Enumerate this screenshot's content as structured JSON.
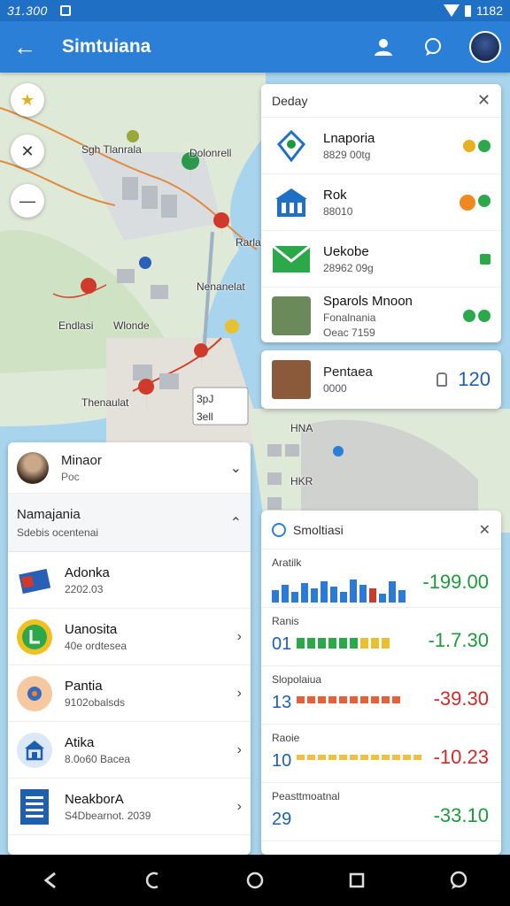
{
  "status": {
    "time": "31.300",
    "right_text": "1182"
  },
  "appbar": {
    "title": "Simtuiana",
    "back_icon": "arrow-left-icon"
  },
  "map": {
    "labels": [
      "Sgh Tlanrala",
      "Dolonrell",
      "Rarla",
      "Nenanelat",
      "Endlasi",
      "Wlonde",
      "Thenaulat",
      "HNA",
      "HKR"
    ],
    "bubble_a": "3pJ",
    "bubble_b": "3ell"
  },
  "today": {
    "title": "Deday",
    "items": [
      {
        "name": "Lnaporia",
        "sub": "8829 00tg"
      },
      {
        "name": "Rok",
        "sub": "88010"
      },
      {
        "name": "Uekobe",
        "sub": "28962 09g"
      },
      {
        "name": "Sparols Mnoon",
        "sub": "Fonalnania",
        "sub2": "Oeac 7159"
      }
    ]
  },
  "pentaca": {
    "name": "Pentaea",
    "sub": "0000",
    "value": "120"
  },
  "left_panel": {
    "top": {
      "name": "Minaor",
      "sub": "Poc"
    },
    "section": {
      "name": "Namajania",
      "sub": "Sdebis ocentenai"
    },
    "items": [
      {
        "name": "Adonka",
        "sub": "2202.03"
      },
      {
        "name": "Uanosita",
        "sub": "40e ordtesea"
      },
      {
        "name": "Pantia",
        "sub": "9102obalsds"
      },
      {
        "name": "Atika",
        "sub": "8.0o60 Bacea"
      },
      {
        "name": "NeakborA",
        "sub": "S4Dbearnot. 2039"
      }
    ]
  },
  "stats": {
    "title": "Smoltiasi",
    "rows": [
      {
        "label": "Aratilk",
        "left": "",
        "value": "-199.00",
        "color": "#1e9a3c",
        "bars": [
          14,
          20,
          12,
          22,
          16,
          24,
          18,
          12,
          26,
          20,
          16,
          10,
          24,
          14
        ],
        "barcolor": "#2a7ad6"
      },
      {
        "label": "Ranis",
        "left": "01",
        "value": "-1.7.30",
        "color": "#1e9a3c",
        "bars": [
          12,
          12,
          12,
          12,
          12,
          12,
          12,
          12,
          12
        ],
        "barcolor": "#2aa84a"
      },
      {
        "label": "Slopolaiua",
        "left": "13",
        "value": "-39.30",
        "color": "#d02a2a",
        "bars": [
          8,
          8,
          8,
          8,
          8,
          8,
          8,
          8,
          8,
          8
        ],
        "barcolor": "#e8603a"
      },
      {
        "label": "Raoie",
        "left": "10",
        "value": "-10.23",
        "color": "#d02a2a",
        "bars": [
          6,
          6,
          6,
          6,
          6,
          6,
          6,
          6,
          6,
          6,
          6,
          6
        ],
        "barcolor": "#f0c040"
      },
      {
        "label": "Peasttmoatnal",
        "left": "29",
        "value": "-33.10",
        "color": "#1e9a3c",
        "bars": [],
        "barcolor": "#000"
      }
    ]
  }
}
